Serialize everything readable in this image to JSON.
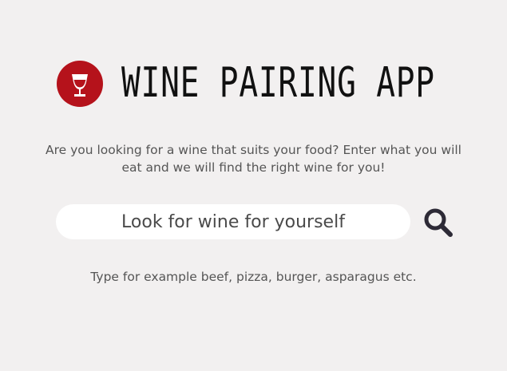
{
  "header": {
    "logo_icon": "wine-glass-icon",
    "title": "WINE PAIRING APP"
  },
  "intro": {
    "line1": "Are you looking for a wine that suits your food? Enter what you will",
    "line2": "eat and we will find the right wine for you!"
  },
  "search": {
    "placeholder": "Look for wine for yourself",
    "value": "",
    "button_icon": "search-icon"
  },
  "hint": "Type for example beef, pizza, burger, asparagus etc.",
  "colors": {
    "background": "#f2f0f0",
    "logo_red": "#b5121b",
    "search_icon": "#2d2a36"
  }
}
